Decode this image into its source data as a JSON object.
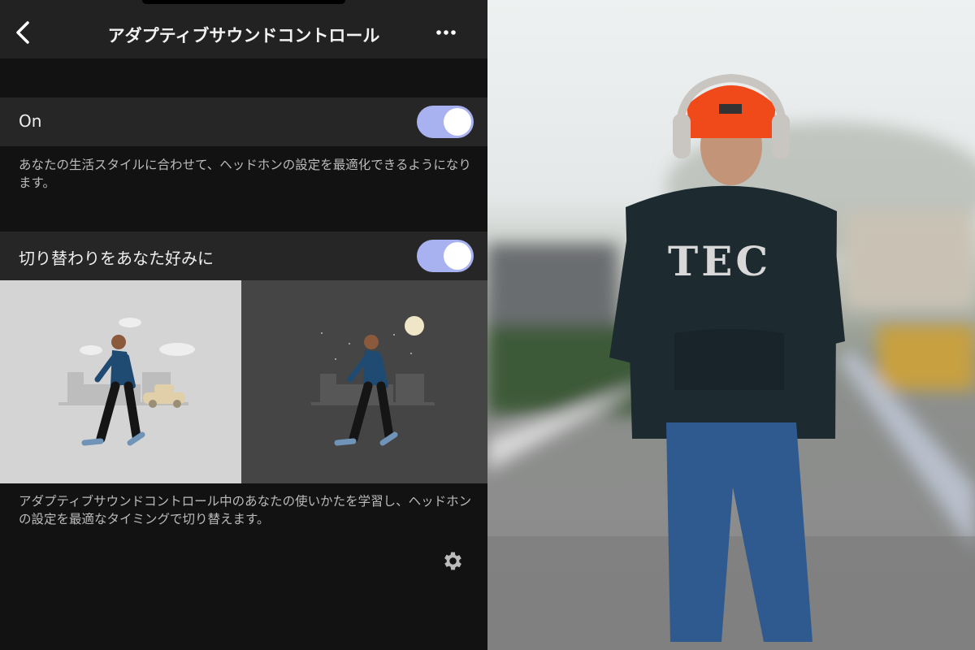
{
  "header": {
    "title": "アダプティブサウンドコントロール",
    "back_icon": "chevron-left-icon",
    "more_icon": "more-horizontal-icon"
  },
  "settings": [
    {
      "label": "On",
      "enabled": true,
      "description": "あなたの生活スタイルに合わせて、ヘッドホンの設定を最適化できるようになります。"
    },
    {
      "label": "切り替わりをあなた好みに",
      "enabled": true,
      "description": "アダプティブサウンドコントロール中のあなたの使いかたを学習し、ヘッドホンの設定を最適なタイミングで切り替えます。"
    }
  ],
  "footer": {
    "settings_icon": "gear-icon"
  },
  "photo": {
    "hoodie_text": "TEC"
  },
  "colors": {
    "toggle_on": "#a8b2f0",
    "header_bg": "#222222",
    "row_bg": "#262626",
    "background": "#121212"
  }
}
